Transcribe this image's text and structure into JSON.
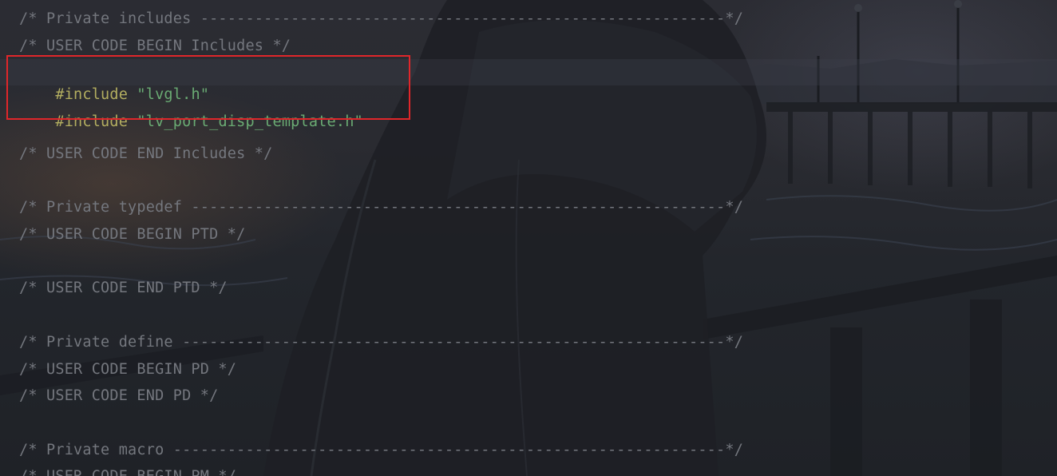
{
  "editor": {
    "lines": [
      {
        "text": "/* Private includes ----------------------------------------------------------*/",
        "kind": "comment"
      },
      {
        "text": "/* USER CODE BEGIN Includes */",
        "kind": "comment"
      },
      {
        "keyword": "#include",
        "string": "\"lvgl.h\"",
        "kind": "include"
      },
      {
        "keyword": "#include",
        "string": "\"lv_port_disp_template.h\"",
        "kind": "include"
      },
      {
        "text": "/* USER CODE END Includes */",
        "kind": "comment"
      },
      {
        "text": "/* Private typedef -----------------------------------------------------------*/",
        "kind": "comment"
      },
      {
        "text": "/* USER CODE BEGIN PTD */",
        "kind": "comment"
      },
      {
        "text": "/* USER CODE END PTD */",
        "kind": "comment"
      },
      {
        "text": "/* Private define ------------------------------------------------------------*/",
        "kind": "comment"
      },
      {
        "text": "/* USER CODE BEGIN PD */",
        "kind": "comment"
      },
      {
        "text": "/* USER CODE END PD */",
        "kind": "comment"
      },
      {
        "text": "/* Private macro -------------------------------------------------------------*/",
        "kind": "comment"
      },
      {
        "text": "/* USER CODE BEGIN PM */",
        "kind": "comment"
      }
    ]
  },
  "colors": {
    "comment": "#74777e",
    "keyword": "#b3ae60",
    "string": "#6aab73",
    "highlight_border": "#e0262a"
  }
}
